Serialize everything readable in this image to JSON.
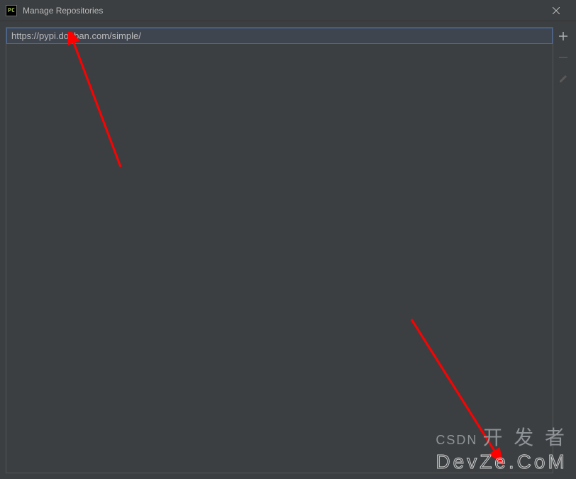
{
  "window": {
    "title": "Manage Repositories",
    "icon_label": "PC"
  },
  "repositories": {
    "items": [
      {
        "url": "https://pypi.douban.com/simple/"
      }
    ]
  },
  "toolbar": {
    "add": "+",
    "remove": "−",
    "edit": "edit"
  },
  "watermark": {
    "prefix": "CSDN",
    "brand1": "开 发 者",
    "brand2": "DevZe.CoM"
  }
}
